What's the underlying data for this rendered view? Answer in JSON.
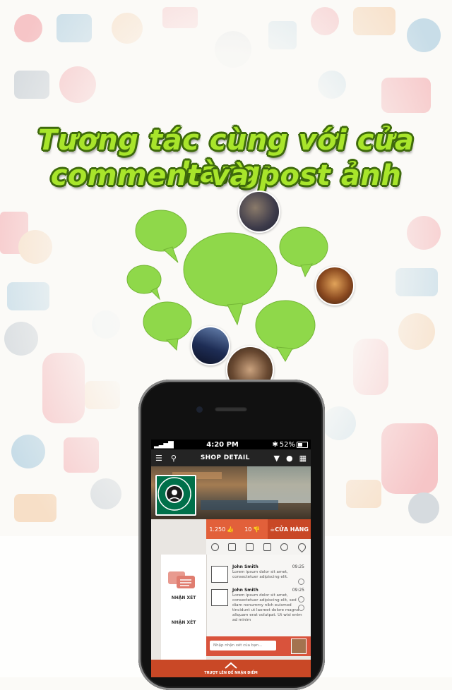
{
  "headline": {
    "line1": "Tương tác cùng với cửa hàng:",
    "line2": "comment và post ảnh"
  },
  "colors": {
    "headline_green": "#a8e52b",
    "bubble_green": "#8fd84a",
    "accent_orange": "#e2603a",
    "nav_dark": "#242424"
  },
  "phone": {
    "status": {
      "carrier_signal": "",
      "time": "4:20 PM",
      "battery": "52%"
    },
    "navbar": {
      "title": "SHOP DETAIL",
      "icons": [
        "menu-icon",
        "search-icon",
        "filter-icon",
        "user-icon",
        "grid-icon"
      ]
    },
    "store": {
      "logo_text": "STARBUCKS COFFEE",
      "likes": "1.250",
      "dislikes": "10",
      "store_button": "CỬA HÀNG",
      "tabs": [
        "info-icon",
        "list-icon",
        "camera-icon",
        "document-icon",
        "comment-icon",
        "location-icon"
      ]
    },
    "sidebar": {
      "items": [
        {
          "label": "NHẬN XÉT"
        },
        {
          "label": "NHẬN XÉT"
        }
      ]
    },
    "comments": [
      {
        "name": "John Smith",
        "time": "09:25",
        "text": "Lorem ipsum dolor sit amet, consectetuer adipiscing elit."
      },
      {
        "name": "John Smith",
        "time": "09:25",
        "text": "Lorem ipsum dolor sit amet, consectetuer adipiscing elit, sed diam nonummy nibh euismod tincidunt ut laoreet dolore magna aliquam erat volutpat. Ut wisi enim ad minim"
      }
    ],
    "composer": {
      "placeholder": "Nhập nhận xét của bạn..."
    },
    "footer": {
      "label": "TRƯỢT LÊN ĐỂ NHẬN ĐIỂM"
    }
  }
}
